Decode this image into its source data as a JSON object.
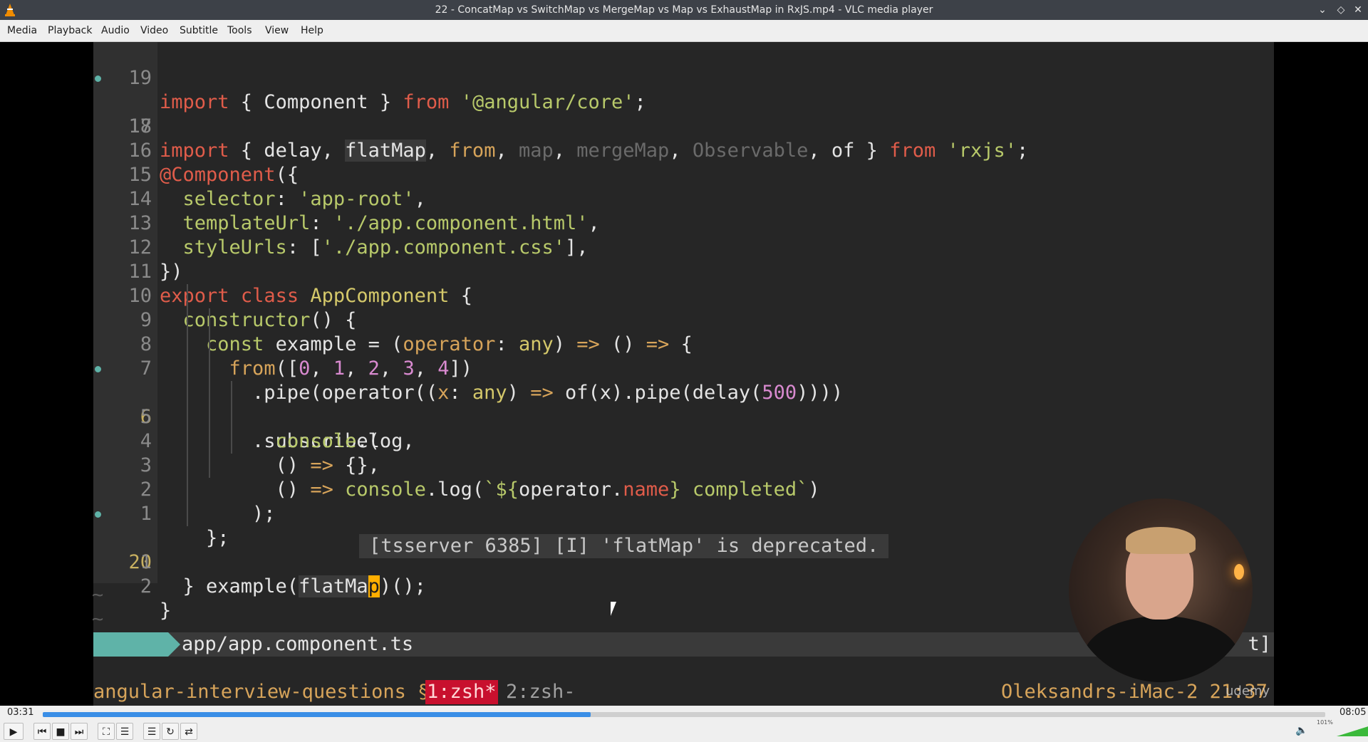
{
  "window": {
    "title": "22 - ConcatMap vs SwitchMap vs MergeMap vs Map vs ExhaustMap in RxJS.mp4 - VLC media player"
  },
  "menu": [
    "Media",
    "Playback",
    "Audio",
    "Video",
    "Subtitle",
    "Tools",
    "View",
    "Help"
  ],
  "editor": {
    "lines": [
      {
        "n": "19",
        "dot": false
      },
      {
        "n": "18",
        "dot": true
      },
      {
        "n": "17",
        "dot": false
      },
      {
        "n": "16",
        "dot": false
      },
      {
        "n": "15",
        "dot": false
      },
      {
        "n": "14",
        "dot": false
      },
      {
        "n": "13",
        "dot": false
      },
      {
        "n": "12",
        "dot": false
      },
      {
        "n": "11",
        "dot": false
      },
      {
        "n": "10",
        "dot": false
      },
      {
        "n": "9",
        "dot": false
      },
      {
        "n": "8",
        "dot": false
      },
      {
        "n": "7",
        "dot": false
      },
      {
        "n": "6",
        "dot": true
      },
      {
        "n": "5",
        "dot": false
      },
      {
        "n": "4",
        "dot": false
      },
      {
        "n": "3",
        "dot": false
      },
      {
        "n": "2",
        "dot": false
      },
      {
        "n": "1",
        "dot": false
      },
      {
        "n": "20",
        "dot": true
      },
      {
        "n": "1",
        "dot": false
      },
      {
        "n": "2",
        "dot": false
      }
    ],
    "tooltip": "[tsserver 6385] [I] 'flatMap' is deprecated.",
    "tilde": "~",
    "status_filename": "app/app.component.ts",
    "status_right": "t]"
  },
  "tmux": {
    "session": "angular-interview-questions §",
    "window1": "1:zsh*",
    "window2": "2:zsh-",
    "host": "Oleksandrs-iMac-2 21:37"
  },
  "watermark": "udemy",
  "player": {
    "elapsed": "03:31",
    "total": "08:05",
    "progress": 0.427,
    "volume_pct": "101%",
    "volume_level": 1.01
  },
  "colors": {
    "accent": "#3a8ee6",
    "volume": "#3bb93b",
    "tmux_active": "#c8102e"
  }
}
